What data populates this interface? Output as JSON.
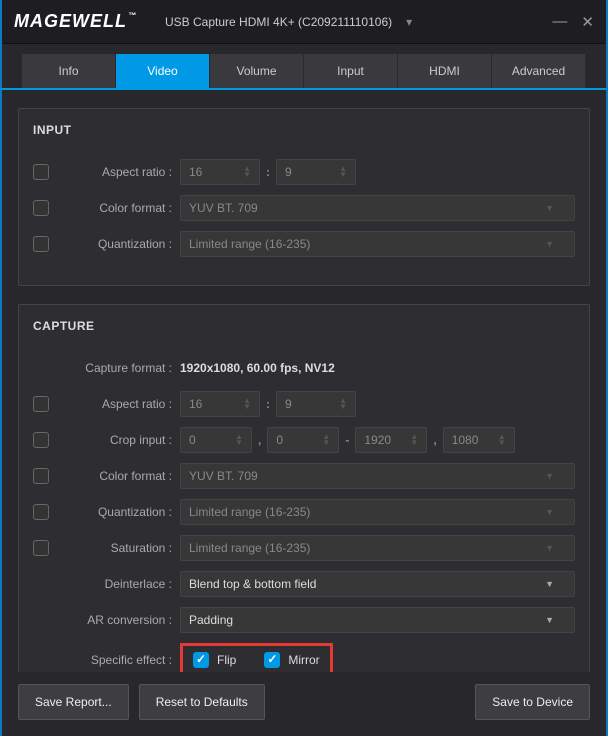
{
  "titlebar": {
    "logo": "MAGEWELL",
    "device": "USB Capture HDMI 4K+ (C209211110106)"
  },
  "tabs": {
    "info": "Info",
    "video": "Video",
    "volume": "Volume",
    "input": "Input",
    "hdmi": "HDMI",
    "advanced": "Advanced"
  },
  "input": {
    "title": "INPUT",
    "aspect_label": "Aspect ratio :",
    "aspect_w": "16",
    "aspect_h": "9",
    "colorfmt_label": "Color format :",
    "colorfmt": "YUV BT. 709",
    "quant_label": "Quantization :",
    "quant": "Limited range (16-235)"
  },
  "capture": {
    "title": "CAPTURE",
    "capfmt_label": "Capture format :",
    "capfmt": "1920x1080, 60.00 fps, NV12",
    "aspect_label": "Aspect ratio :",
    "aspect_w": "16",
    "aspect_h": "9",
    "crop_label": "Crop input :",
    "crop_x": "0",
    "crop_y": "0",
    "crop_w": "1920",
    "crop_h": "1080",
    "colorfmt_label": "Color format :",
    "colorfmt": "YUV BT. 709",
    "quant_label": "Quantization :",
    "quant": "Limited range (16-235)",
    "sat_label": "Saturation :",
    "sat": "Limited range (16-235)",
    "deint_label": "Deinterlace :",
    "deint": "Blend top & bottom field",
    "arconv_label": "AR conversion :",
    "arconv": "Padding",
    "effect_label": "Specific effect :",
    "flip": "Flip",
    "mirror": "Mirror"
  },
  "footer": {
    "save_report": "Save Report...",
    "reset": "Reset to Defaults",
    "save_device": "Save to Device"
  }
}
